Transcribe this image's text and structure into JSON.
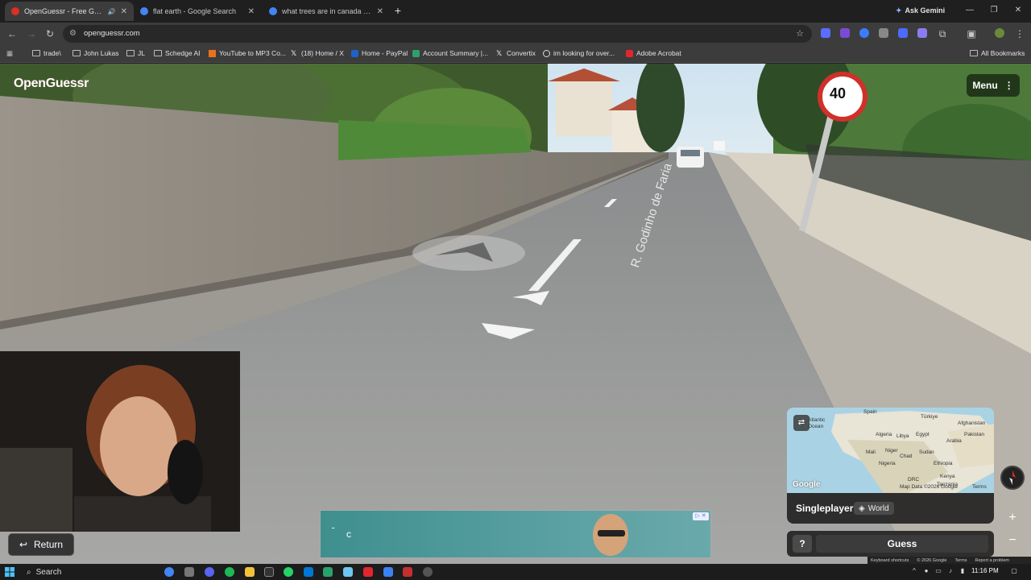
{
  "browser": {
    "tabs": [
      {
        "title": "OpenGuessr - Free GeoGue",
        "active": true,
        "favicon_color": "#d93025"
      },
      {
        "title": "flat earth - Google Search",
        "active": false,
        "favicon_color": "#4285f4"
      },
      {
        "title": "what trees are in canada - Goo",
        "active": false,
        "favicon_color": "#4285f4"
      }
    ],
    "new_tab": "+",
    "ask_gemini": "Ask Gemini",
    "url": "openguessr.com",
    "bookmarks": [
      {
        "label": "trade\\",
        "icon": "folder-icon"
      },
      {
        "label": "John Lukas",
        "icon": "folder-icon"
      },
      {
        "label": "JL",
        "icon": "folder-icon"
      },
      {
        "label": "Schedge AI",
        "icon": "folder-icon"
      },
      {
        "label": "YouTube to MP3 Co...",
        "icon": "mp3-icon"
      },
      {
        "label": "(18) Home / X",
        "icon": "x-icon"
      },
      {
        "label": "Home - PayPal",
        "icon": "paypal-icon"
      },
      {
        "label": "Account Summary |...",
        "icon": "bank-icon"
      },
      {
        "label": "Convertix",
        "icon": "x-icon"
      },
      {
        "label": "im looking for over...",
        "icon": "openai-icon"
      },
      {
        "label": "Adobe Acrobat",
        "icon": "acrobat-icon"
      }
    ],
    "all_bookmarks": "All Bookmarks"
  },
  "game": {
    "logo": "OpenGuessr",
    "menu_label": "Menu",
    "return_label": "Return",
    "ad_text": "c",
    "map": {
      "labels": [
        "Spain",
        "Türkiye",
        "Algeria",
        "Libya",
        "Egypt",
        "Mali",
        "Niger",
        "Chad",
        "Sudan",
        "Nigeria",
        "Ethiopia",
        "Afghanistan",
        "Pakistan",
        "Arabia",
        "Kenya",
        "Tanzania",
        "DRC",
        "Atlantic",
        "Ocean"
      ],
      "map_data": "Map Data ©2026 Google",
      "terms": "Terms",
      "watermark": "Google"
    },
    "mode": "Singleplayer",
    "region": "World",
    "help": "?",
    "guess_label": "Guess",
    "streetview_footer": [
      "Keyboard shortcuts",
      "© 2026 Google",
      "Terms",
      "Report a problem"
    ],
    "scene": {
      "street_name": "R. Godinho de Faria",
      "speed_limit": "40"
    }
  },
  "taskbar": {
    "search_placeholder": "Search",
    "time": "11:16 PM"
  }
}
